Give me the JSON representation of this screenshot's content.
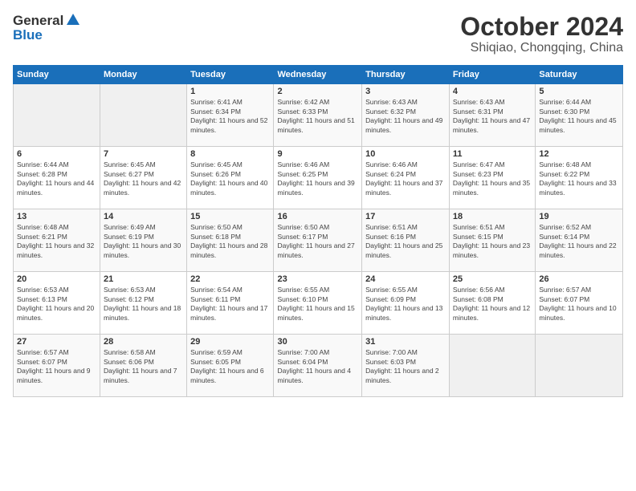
{
  "logo": {
    "line1": "General",
    "line2": "Blue"
  },
  "title": "October 2024",
  "subtitle": "Shiqiao, Chongqing, China",
  "days_of_week": [
    "Sunday",
    "Monday",
    "Tuesday",
    "Wednesday",
    "Thursday",
    "Friday",
    "Saturday"
  ],
  "weeks": [
    [
      {
        "day": "",
        "info": ""
      },
      {
        "day": "",
        "info": ""
      },
      {
        "day": "1",
        "info": "Sunrise: 6:41 AM\nSunset: 6:34 PM\nDaylight: 11 hours and 52 minutes."
      },
      {
        "day": "2",
        "info": "Sunrise: 6:42 AM\nSunset: 6:33 PM\nDaylight: 11 hours and 51 minutes."
      },
      {
        "day": "3",
        "info": "Sunrise: 6:43 AM\nSunset: 6:32 PM\nDaylight: 11 hours and 49 minutes."
      },
      {
        "day": "4",
        "info": "Sunrise: 6:43 AM\nSunset: 6:31 PM\nDaylight: 11 hours and 47 minutes."
      },
      {
        "day": "5",
        "info": "Sunrise: 6:44 AM\nSunset: 6:30 PM\nDaylight: 11 hours and 45 minutes."
      }
    ],
    [
      {
        "day": "6",
        "info": "Sunrise: 6:44 AM\nSunset: 6:28 PM\nDaylight: 11 hours and 44 minutes."
      },
      {
        "day": "7",
        "info": "Sunrise: 6:45 AM\nSunset: 6:27 PM\nDaylight: 11 hours and 42 minutes."
      },
      {
        "day": "8",
        "info": "Sunrise: 6:45 AM\nSunset: 6:26 PM\nDaylight: 11 hours and 40 minutes."
      },
      {
        "day": "9",
        "info": "Sunrise: 6:46 AM\nSunset: 6:25 PM\nDaylight: 11 hours and 39 minutes."
      },
      {
        "day": "10",
        "info": "Sunrise: 6:46 AM\nSunset: 6:24 PM\nDaylight: 11 hours and 37 minutes."
      },
      {
        "day": "11",
        "info": "Sunrise: 6:47 AM\nSunset: 6:23 PM\nDaylight: 11 hours and 35 minutes."
      },
      {
        "day": "12",
        "info": "Sunrise: 6:48 AM\nSunset: 6:22 PM\nDaylight: 11 hours and 33 minutes."
      }
    ],
    [
      {
        "day": "13",
        "info": "Sunrise: 6:48 AM\nSunset: 6:21 PM\nDaylight: 11 hours and 32 minutes."
      },
      {
        "day": "14",
        "info": "Sunrise: 6:49 AM\nSunset: 6:19 PM\nDaylight: 11 hours and 30 minutes."
      },
      {
        "day": "15",
        "info": "Sunrise: 6:50 AM\nSunset: 6:18 PM\nDaylight: 11 hours and 28 minutes."
      },
      {
        "day": "16",
        "info": "Sunrise: 6:50 AM\nSunset: 6:17 PM\nDaylight: 11 hours and 27 minutes."
      },
      {
        "day": "17",
        "info": "Sunrise: 6:51 AM\nSunset: 6:16 PM\nDaylight: 11 hours and 25 minutes."
      },
      {
        "day": "18",
        "info": "Sunrise: 6:51 AM\nSunset: 6:15 PM\nDaylight: 11 hours and 23 minutes."
      },
      {
        "day": "19",
        "info": "Sunrise: 6:52 AM\nSunset: 6:14 PM\nDaylight: 11 hours and 22 minutes."
      }
    ],
    [
      {
        "day": "20",
        "info": "Sunrise: 6:53 AM\nSunset: 6:13 PM\nDaylight: 11 hours and 20 minutes."
      },
      {
        "day": "21",
        "info": "Sunrise: 6:53 AM\nSunset: 6:12 PM\nDaylight: 11 hours and 18 minutes."
      },
      {
        "day": "22",
        "info": "Sunrise: 6:54 AM\nSunset: 6:11 PM\nDaylight: 11 hours and 17 minutes."
      },
      {
        "day": "23",
        "info": "Sunrise: 6:55 AM\nSunset: 6:10 PM\nDaylight: 11 hours and 15 minutes."
      },
      {
        "day": "24",
        "info": "Sunrise: 6:55 AM\nSunset: 6:09 PM\nDaylight: 11 hours and 13 minutes."
      },
      {
        "day": "25",
        "info": "Sunrise: 6:56 AM\nSunset: 6:08 PM\nDaylight: 11 hours and 12 minutes."
      },
      {
        "day": "26",
        "info": "Sunrise: 6:57 AM\nSunset: 6:07 PM\nDaylight: 11 hours and 10 minutes."
      }
    ],
    [
      {
        "day": "27",
        "info": "Sunrise: 6:57 AM\nSunset: 6:07 PM\nDaylight: 11 hours and 9 minutes."
      },
      {
        "day": "28",
        "info": "Sunrise: 6:58 AM\nSunset: 6:06 PM\nDaylight: 11 hours and 7 minutes."
      },
      {
        "day": "29",
        "info": "Sunrise: 6:59 AM\nSunset: 6:05 PM\nDaylight: 11 hours and 6 minutes."
      },
      {
        "day": "30",
        "info": "Sunrise: 7:00 AM\nSunset: 6:04 PM\nDaylight: 11 hours and 4 minutes."
      },
      {
        "day": "31",
        "info": "Sunrise: 7:00 AM\nSunset: 6:03 PM\nDaylight: 11 hours and 2 minutes."
      },
      {
        "day": "",
        "info": ""
      },
      {
        "day": "",
        "info": ""
      }
    ]
  ]
}
